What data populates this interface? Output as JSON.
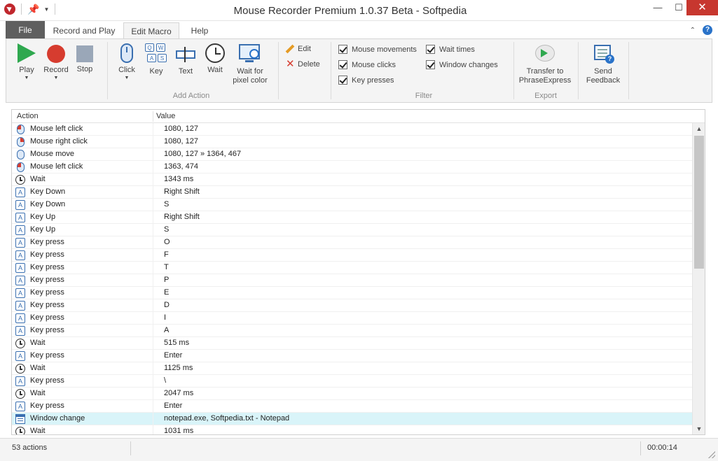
{
  "window": {
    "title": "Mouse Recorder Premium 1.0.37 Beta - Softpedia",
    "minimize": "—",
    "maximize": "☐",
    "close": "✕"
  },
  "tabs": {
    "file": "File",
    "record_and_play": "Record and Play",
    "edit_macro": "Edit Macro",
    "help": "Help",
    "active": "Edit Macro"
  },
  "ribbon": {
    "play": "Play",
    "record": "Record",
    "stop": "Stop",
    "add_action": {
      "label": "Add Action",
      "click": "Click",
      "key": "Key",
      "text": "Text",
      "wait": "Wait",
      "wait_pixel_line1": "Wait for",
      "wait_pixel_line2": "pixel color"
    },
    "edit": "Edit",
    "delete": "Delete",
    "filter": {
      "label": "Filter",
      "mouse_movements": "Mouse movements",
      "mouse_clicks": "Mouse clicks",
      "key_presses": "Key presses",
      "wait_times": "Wait times",
      "window_changes": "Window changes"
    },
    "export": {
      "label": "Export",
      "transfer_line1": "Transfer to",
      "transfer_line2": "PhraseExpress"
    },
    "send_feedback_line1": "Send",
    "send_feedback_line2": "Feedback"
  },
  "table": {
    "col_action": "Action",
    "col_value": "Value",
    "rows": [
      {
        "icon": "mouse-left-icon",
        "action": "Mouse left click",
        "value": "1080, 127"
      },
      {
        "icon": "mouse-right-icon",
        "action": "Mouse right click",
        "value": "1080, 127"
      },
      {
        "icon": "mouse-icon",
        "action": "Mouse move",
        "value": "1080, 127 » 1364, 467"
      },
      {
        "icon": "mouse-left-icon",
        "action": "Mouse left click",
        "value": "1363, 474"
      },
      {
        "icon": "clock-icon",
        "action": "Wait",
        "value": "1343 ms"
      },
      {
        "icon": "key-icon",
        "action": "Key Down",
        "value": "Right Shift"
      },
      {
        "icon": "key-icon",
        "action": "Key Down",
        "value": "S"
      },
      {
        "icon": "key-icon",
        "action": "Key Up",
        "value": "Right Shift"
      },
      {
        "icon": "key-icon",
        "action": "Key Up",
        "value": "S"
      },
      {
        "icon": "key-icon",
        "action": "Key press",
        "value": "O"
      },
      {
        "icon": "key-icon",
        "action": "Key press",
        "value": "F"
      },
      {
        "icon": "key-icon",
        "action": "Key press",
        "value": "T"
      },
      {
        "icon": "key-icon",
        "action": "Key press",
        "value": "P"
      },
      {
        "icon": "key-icon",
        "action": "Key press",
        "value": "E"
      },
      {
        "icon": "key-icon",
        "action": "Key press",
        "value": "D"
      },
      {
        "icon": "key-icon",
        "action": "Key press",
        "value": "I"
      },
      {
        "icon": "key-icon",
        "action": "Key press",
        "value": "A"
      },
      {
        "icon": "clock-icon",
        "action": "Wait",
        "value": "515 ms"
      },
      {
        "icon": "key-icon",
        "action": "Key press",
        "value": "Enter"
      },
      {
        "icon": "clock-icon",
        "action": "Wait",
        "value": "1125 ms"
      },
      {
        "icon": "key-icon",
        "action": "Key press",
        "value": "\\"
      },
      {
        "icon": "clock-icon",
        "action": "Wait",
        "value": "2047 ms"
      },
      {
        "icon": "key-icon",
        "action": "Key press",
        "value": "Enter"
      },
      {
        "icon": "window-icon",
        "action": "Window change",
        "value": "notepad.exe, Softpedia.txt - Notepad",
        "selected": true
      },
      {
        "icon": "clock-icon",
        "action": "Wait",
        "value": "1031 ms"
      }
    ]
  },
  "status": {
    "count": "53 actions",
    "time": "00:00:14"
  },
  "colors": {
    "accent": "#2a73c9",
    "play": "#2fa84f",
    "record": "#d63c2f",
    "selected_row": "#d9f4f9",
    "file_tab": "#5f5f5f"
  }
}
